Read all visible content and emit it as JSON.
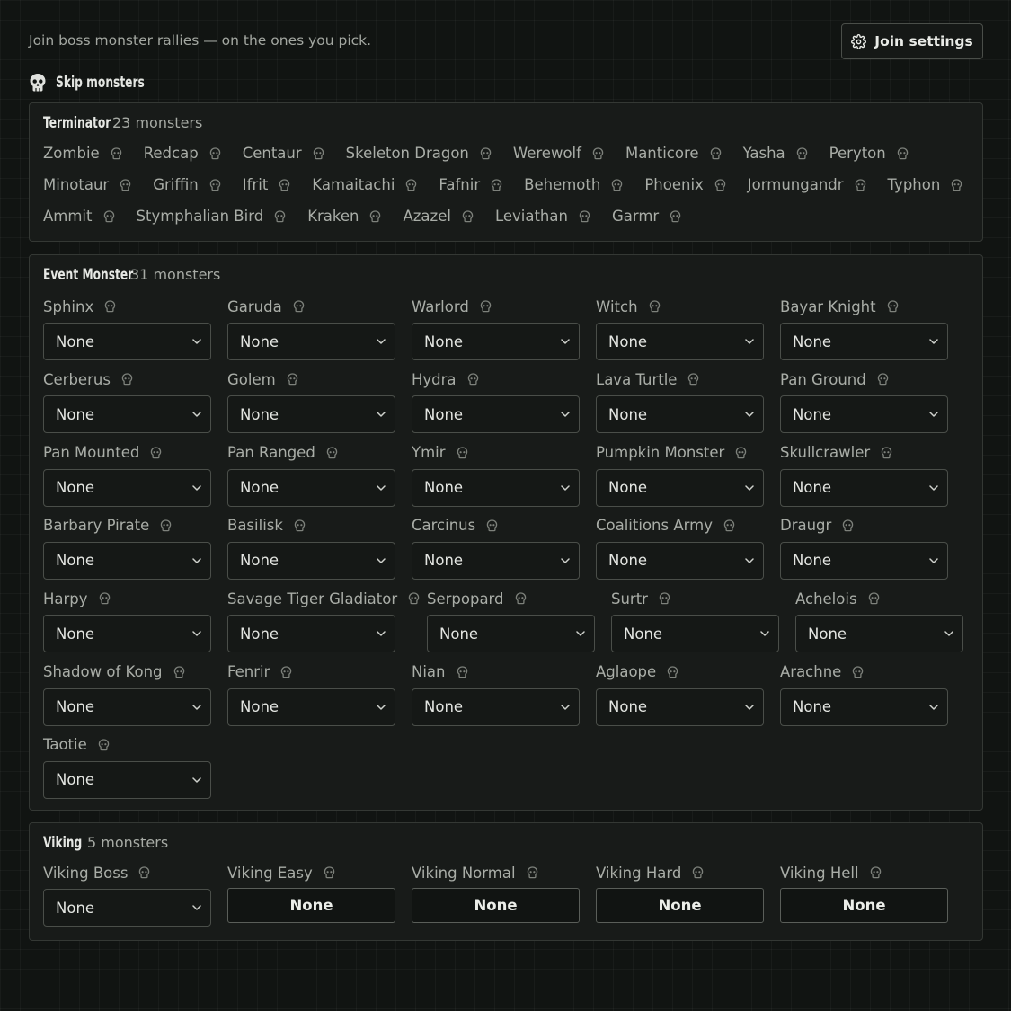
{
  "header": {
    "tagline": "Join boss monster rallies — on the ones you pick.",
    "join_settings_label": "Join settings",
    "skip_monsters_label": "Skip monsters"
  },
  "terminator": {
    "title": "Terminator",
    "count": "23 monsters",
    "rows": [
      [
        "Zombie",
        "Redcap",
        "Centaur",
        "Skeleton Dragon",
        "Werewolf",
        "Manticore",
        "Yasha",
        "Peryton"
      ],
      [
        "Minotaur",
        "Griffin",
        "Ifrit",
        "Kamaitachi",
        "Fafnir",
        "Behemoth",
        "Phoenix",
        "Jormungandr",
        "Typhon"
      ],
      [
        "Ammit",
        "Stymphalian Bird",
        "Kraken",
        "Azazel",
        "Leviathan",
        "Garmr"
      ]
    ]
  },
  "event": {
    "title": "Event Monster",
    "count": "31 monsters",
    "monsters": [
      {
        "name": "Sphinx",
        "value": "None"
      },
      {
        "name": "Garuda",
        "value": "None"
      },
      {
        "name": "Warlord",
        "value": "None"
      },
      {
        "name": "Witch",
        "value": "None"
      },
      {
        "name": "Bayar Knight",
        "value": "None"
      },
      {
        "name": "Cerberus",
        "value": "None"
      },
      {
        "name": "Golem",
        "value": "None"
      },
      {
        "name": "Hydra",
        "value": "None"
      },
      {
        "name": "Lava Turtle",
        "value": "None"
      },
      {
        "name": "Pan Ground",
        "value": "None"
      },
      {
        "name": "Pan Mounted",
        "value": "None"
      },
      {
        "name": "Pan Ranged",
        "value": "None"
      },
      {
        "name": "Ymir",
        "value": "None"
      },
      {
        "name": "Pumpkin Monster",
        "value": "None"
      },
      {
        "name": "Skullcrawler",
        "value": "None"
      },
      {
        "name": "Barbary Pirate",
        "value": "None"
      },
      {
        "name": "Basilisk",
        "value": "None"
      },
      {
        "name": "Carcinus",
        "value": "None"
      },
      {
        "name": "Coalitions Army",
        "value": "None"
      },
      {
        "name": "Draugr",
        "value": "None"
      },
      {
        "name": "Harpy",
        "value": "None"
      },
      {
        "name": "Savage Tiger Gladiator",
        "value": "None"
      },
      {
        "name": "Serpopard",
        "value": "None"
      },
      {
        "name": "Surtr",
        "value": "None"
      },
      {
        "name": "Achelois",
        "value": "None"
      },
      {
        "name": "Shadow of Kong",
        "value": "None"
      },
      {
        "name": "Fenrir",
        "value": "None"
      },
      {
        "name": "Nian",
        "value": "None"
      },
      {
        "name": "Aglaope",
        "value": "None"
      },
      {
        "name": "Arachne",
        "value": "None"
      },
      {
        "name": "Taotie",
        "value": "None"
      }
    ]
  },
  "viking": {
    "title": "Viking",
    "count": "5 monsters",
    "monsters": [
      {
        "name": "Viking Boss",
        "value": "None",
        "control": "select"
      },
      {
        "name": "Viking Easy",
        "value": "None",
        "control": "button"
      },
      {
        "name": "Viking Normal",
        "value": "None",
        "control": "button"
      },
      {
        "name": "Viking Hard",
        "value": "None",
        "control": "button"
      },
      {
        "name": "Viking Hell",
        "value": "None",
        "control": "button"
      }
    ]
  },
  "icons": {
    "skull": "skull-icon",
    "gear": "gear-icon",
    "chevron": "chevron-down-icon"
  }
}
